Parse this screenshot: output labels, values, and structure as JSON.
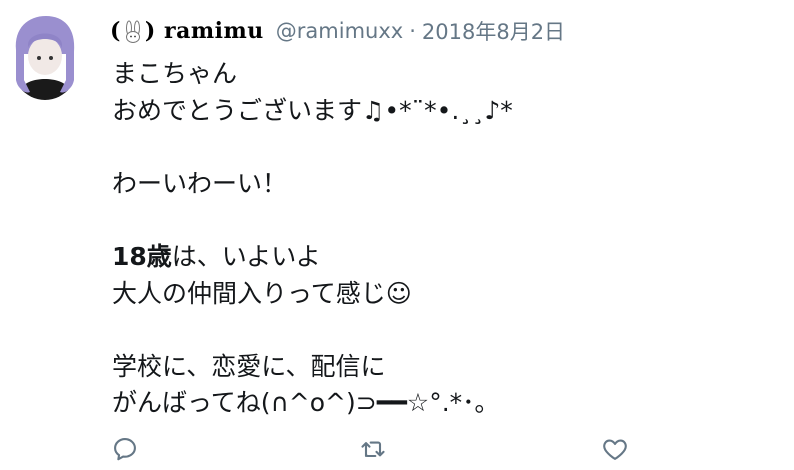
{
  "tweet": {
    "display_name_prefix": "(",
    "display_name_suffix": ")",
    "display_name_text": "ramimu",
    "handle": "@ramimuxx",
    "separator": "·",
    "date": "2018年8月2日",
    "lines": [
      "まこちゃん",
      "おめでとうございます♫•*¨*•.¸¸♪*",
      "",
      "わーいわーい！",
      "",
      "18歳は、いよいよ",
      "大人の仲間入りって感じ😊",
      "",
      "学校に、恋愛に、配信に",
      "がんばってね(∩^o^)⊃━━☆°.*･｡"
    ],
    "line_bold_prefix": "18歳",
    "line_bold_rest": "は、いよいよ",
    "line7_text": "大人の仲間入りって感じ",
    "line7_emoji": "☺"
  },
  "icons": {
    "avatar": "avatar-image",
    "rabbit": "rabbit-icon",
    "reply": "reply-icon",
    "retweet": "retweet-icon",
    "like": "heart-icon"
  },
  "colors": {
    "text": "#14171a",
    "secondary": "#657786",
    "icon": "#657786"
  }
}
